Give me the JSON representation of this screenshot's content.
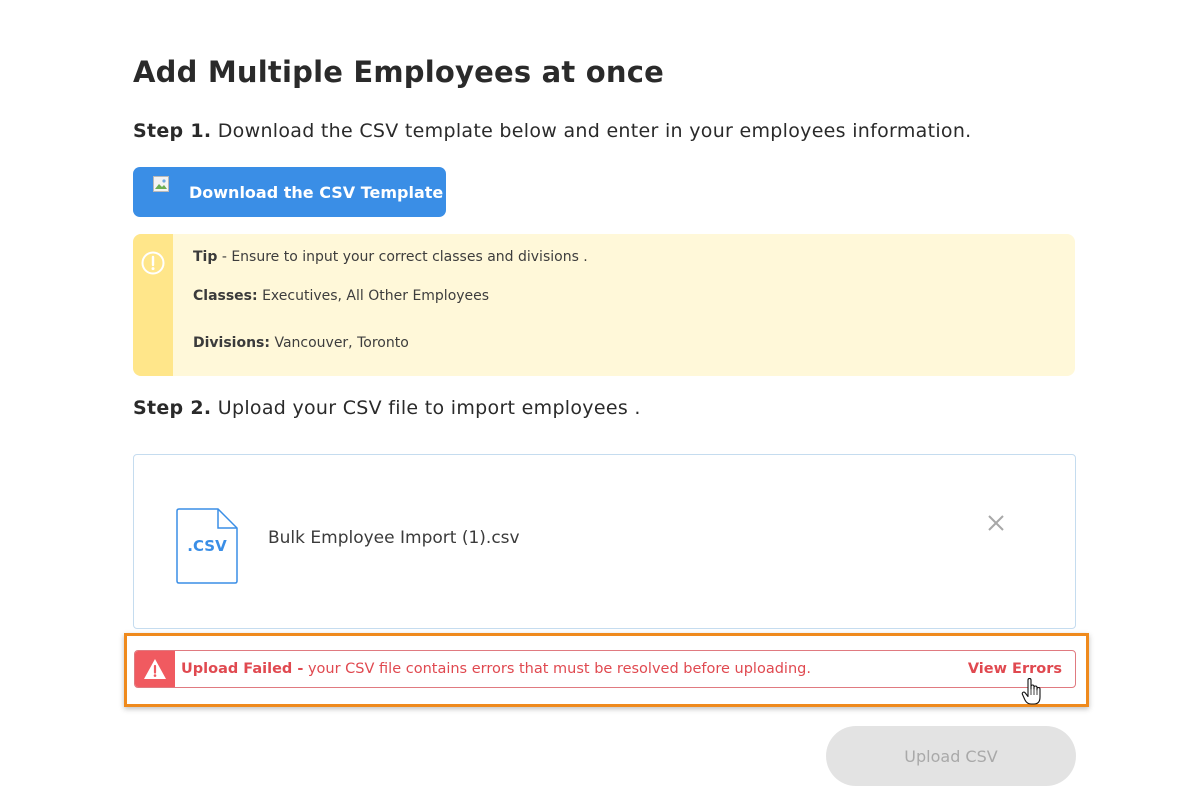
{
  "page": {
    "title": "Add Multiple Employees at once"
  },
  "step1": {
    "label": "Step 1.",
    "text": " Download the CSV template below and enter in your employees information."
  },
  "download_button": {
    "label": "Download the CSV Template",
    "icon": "broken-image-icon"
  },
  "tip": {
    "heading": "Tip",
    "text": " - Ensure to input your correct classes and divisions .",
    "classes_label": "Classes:",
    "classes_value": " Executives, All Other Employees",
    "divisions_label": "Divisions:",
    "divisions_value": " Vancouver, Toronto",
    "icon": "exclamation-circle-icon"
  },
  "step2": {
    "label": "Step 2.",
    "text": " Upload your CSV file to import employees ."
  },
  "file": {
    "name": "Bulk Employee Import (1).csv",
    "icon_label": ".CSV",
    "remove_icon": "close-icon"
  },
  "error": {
    "title": "Upload Failed -",
    "message": " your CSV file contains errors that must be resolved before uploading.",
    "link": "View Errors",
    "icon": "warning-triangle-icon"
  },
  "upload_button": {
    "label": "Upload CSV"
  },
  "colors": {
    "primary": "#3a8ee6",
    "tip_bg": "#fff8d9",
    "tip_bar": "#ffe68a",
    "error": "#e04950",
    "highlight": "#ef8a1d",
    "disabled": "#e3e3e3"
  }
}
